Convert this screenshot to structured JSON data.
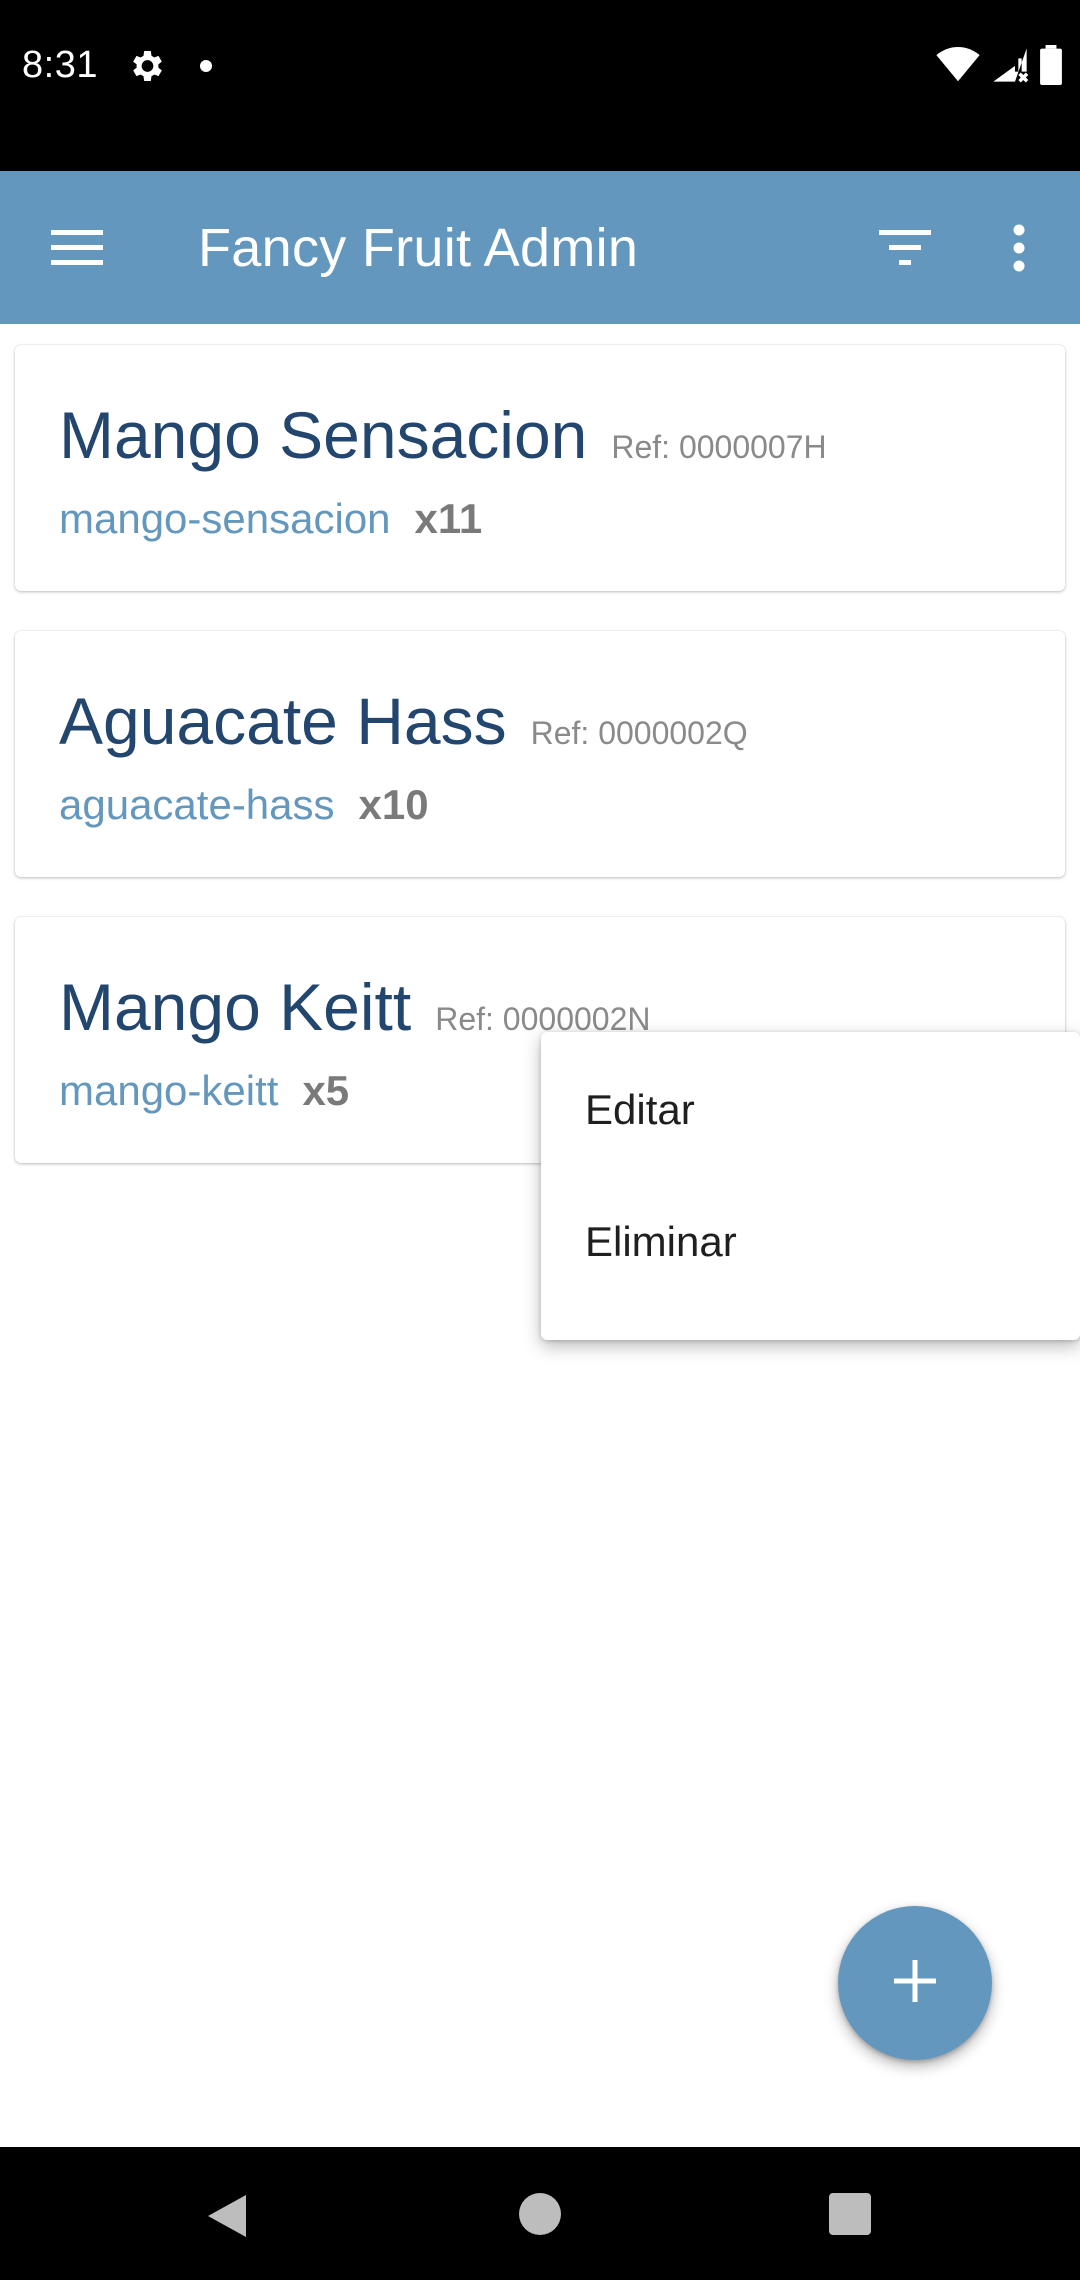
{
  "status_bar": {
    "time": "8:31",
    "icons": [
      "gear-icon",
      "notification-dot-icon",
      "wifi-icon",
      "cell-signal-icon",
      "battery-icon"
    ]
  },
  "app_bar": {
    "title": "Fancy Fruit Admin",
    "background": "#6497bd",
    "icons": [
      "menu-icon",
      "filter-icon",
      "more-vert-icon"
    ]
  },
  "products": [
    {
      "name": "Mango Sensacion",
      "ref": "Ref: 0000007H",
      "slug": "mango-sensacion",
      "quantity": "x11"
    },
    {
      "name": "Aguacate Hass",
      "ref": "Ref: 0000002Q",
      "slug": "aguacate-hass",
      "quantity": "x10"
    },
    {
      "name": "Mango Keitt",
      "ref": "Ref: 0000002N",
      "slug": "mango-keitt",
      "quantity": "x5"
    }
  ],
  "context_menu": {
    "items": [
      "Editar",
      "Eliminar"
    ]
  },
  "fab": {
    "icon": "add-icon",
    "color": "#6497bd"
  },
  "colors": {
    "title_text": "#23466e",
    "slug_text": "#6497bd",
    "ref_text": "#8a8a8a",
    "quantity_text": "#7a7a7a"
  },
  "navigation_bar": {
    "icons": [
      "back-icon",
      "home-icon",
      "recents-icon"
    ]
  }
}
